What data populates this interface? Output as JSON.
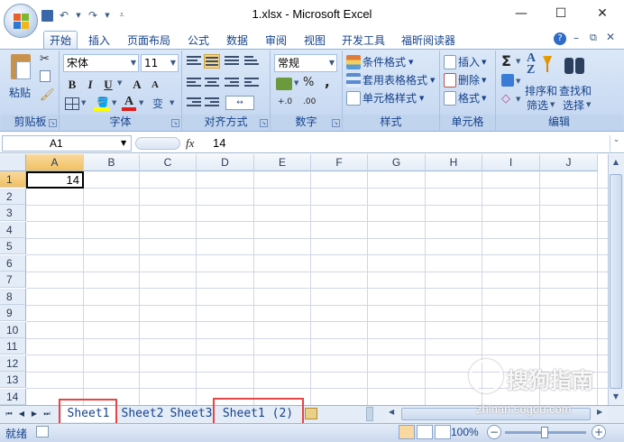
{
  "window": {
    "title": "1.xlsx - Microsoft Excel",
    "minimize": "—",
    "maximize": "☐",
    "close": "✕"
  },
  "ribbon_tabs": [
    "开始",
    "插入",
    "页面布局",
    "公式",
    "数据",
    "审阅",
    "视图",
    "开发工具",
    "福昕阅读器"
  ],
  "clipboard": {
    "paste": "粘贴",
    "label": "剪贴板"
  },
  "font": {
    "name": "宋体",
    "size": "11",
    "label": "字体",
    "bold": "B",
    "italic": "I",
    "underline": "U",
    "grow": "A",
    "shrink": "A",
    "phonetic": "变"
  },
  "alignment": {
    "label": "对齐方式"
  },
  "number": {
    "format": "常规",
    "label": "数字",
    "percent": "%",
    "comma": ",",
    "inc_decimal": "+.0",
    "dec_decimal": ".00"
  },
  "styles": {
    "conditional": "条件格式",
    "table_format": "套用表格格式",
    "cell_styles": "单元格样式",
    "label": "样式"
  },
  "cells": {
    "insert": "插入",
    "delete": "删除",
    "format": "格式",
    "label": "单元格"
  },
  "editing": {
    "sum": "Σ",
    "sort_filter_1": "排序和",
    "sort_filter_2": "筛选",
    "find_select_1": "查找和",
    "find_select_2": "选择",
    "label": "编辑"
  },
  "formula_bar": {
    "name_box": "A1",
    "fx": "fx",
    "value": "14"
  },
  "columns": [
    "A",
    "B",
    "C",
    "D",
    "E",
    "F",
    "G",
    "H",
    "I",
    "J"
  ],
  "rows": [
    "1",
    "2",
    "3",
    "4",
    "5",
    "6",
    "7",
    "8",
    "9",
    "10",
    "11",
    "12",
    "13",
    "14"
  ],
  "cell_a1": "14",
  "sheet_tabs": [
    "Sheet1",
    "Sheet2",
    "Sheet3",
    "Sheet1 (2)"
  ],
  "status": {
    "ready": "就绪",
    "zoom": "100%"
  },
  "watermark": {
    "text": "搜狗指南",
    "url": "zhinan.sogou.com"
  },
  "colors": {
    "ribbon": "#c9daf2",
    "accent": "#15428b",
    "highlight_box": "#e64545",
    "selected_header": "#f1c15f"
  }
}
